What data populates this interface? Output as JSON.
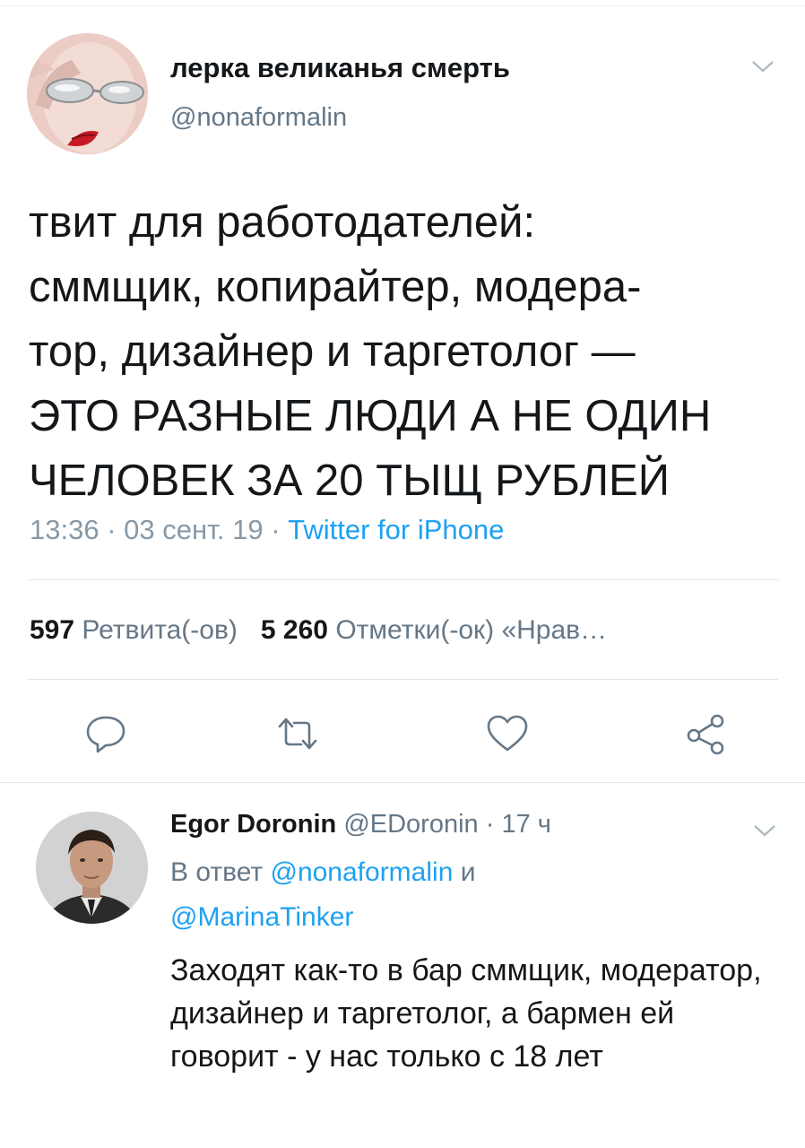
{
  "tweet": {
    "author_name": "лерка великанья смерть",
    "author_handle": "@nonaformalin",
    "lines": [
      "твит для работодателей:",
      "сммщик, копирайтер, модера-",
      "тор, дизайнер и таргетолог —",
      "ЭТО РАЗНЫЕ ЛЮДИ А НЕ ОДИН",
      "ЧЕЛОВЕК ЗА 20 ТЫЩ РУБЛЕЙ"
    ],
    "time": "13:36",
    "date": "03 сент. 19",
    "source": "Twitter for iPhone",
    "retweets_count": "597",
    "retweets_label": "Ретвита(-ов)",
    "likes_count": "5 260",
    "likes_label": "Отметки(-ок) «Нрав…",
    "dot": "·"
  },
  "actions": {
    "reply_icon": "reply-icon",
    "retweet_icon": "retweet-icon",
    "like_icon": "heart-icon",
    "share_icon": "share-icon"
  },
  "reply": {
    "author_name": "Egor Doronin",
    "author_handle": "@EDoronin",
    "time_ago": "17 ч",
    "reply_prefix": "В ответ",
    "reply_to_1": "@nonaformalin",
    "reply_and": "и",
    "reply_to_2": "@MarinaTinker",
    "text": "Заходят как-то в бар сммщик, модератор, дизайнер и таргетолог, а бармен ей говорит - у нас только с 18 лет"
  },
  "colors": {
    "link": "#1da1f2",
    "secondary_text": "#657786",
    "meta_text": "#8899a6",
    "divider": "#e1e8ed"
  }
}
